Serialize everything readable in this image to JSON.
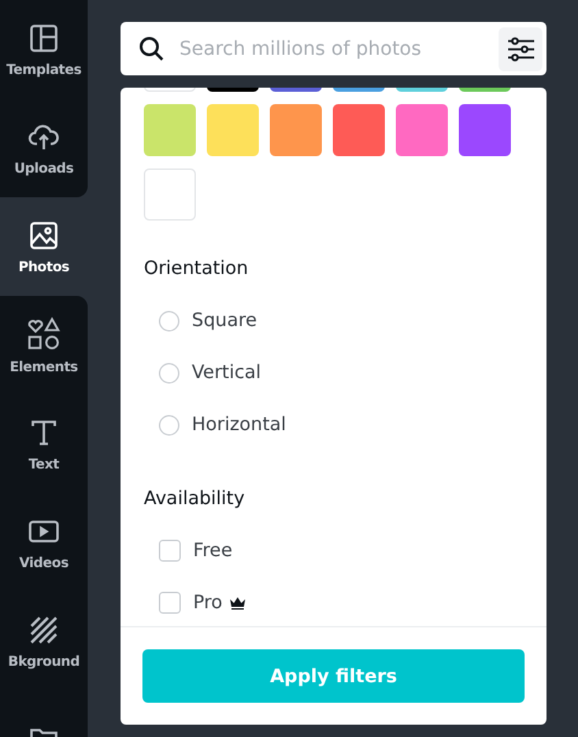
{
  "sidebar": {
    "items": [
      {
        "kind": "templates",
        "label": "Templates",
        "selected": false
      },
      {
        "kind": "uploads",
        "label": "Uploads",
        "selected": false
      },
      {
        "kind": "photos",
        "label": "Photos",
        "selected": true
      },
      {
        "kind": "elements",
        "label": "Elements",
        "selected": false
      },
      {
        "kind": "text",
        "label": "Text",
        "selected": false
      },
      {
        "kind": "videos",
        "label": "Videos",
        "selected": false
      },
      {
        "kind": "background",
        "label": "Bkground",
        "selected": false
      },
      {
        "kind": "folder",
        "selected": false
      }
    ]
  },
  "search": {
    "placeholder": "Search millions of photos"
  },
  "filters": {
    "color_swatches": [
      {
        "color": "#ffffff"
      },
      {
        "color": "#000000"
      },
      {
        "color": "#5b5fd6"
      },
      {
        "color": "#4a9fe0"
      },
      {
        "color": "#5fd0dc"
      },
      {
        "color": "#6cc95a"
      },
      {
        "color": "#cae46a"
      },
      {
        "color": "#fde05a"
      },
      {
        "color": "#fe954c"
      },
      {
        "color": "#fe5b56"
      },
      {
        "color": "#ff69c1"
      },
      {
        "color": "#9b48fe"
      },
      {
        "color": "#ffffff"
      }
    ],
    "orientation": {
      "heading": "Orientation",
      "options": [
        {
          "label": "Square",
          "selected": false
        },
        {
          "label": "Vertical",
          "selected": false
        },
        {
          "label": "Horizontal",
          "selected": false
        }
      ]
    },
    "availability": {
      "heading": "Availability",
      "options": [
        {
          "label": "Free",
          "checked": false,
          "premium": false
        },
        {
          "label": "Pro",
          "checked": false,
          "premium": true
        }
      ]
    },
    "apply_button": "Apply filters"
  }
}
